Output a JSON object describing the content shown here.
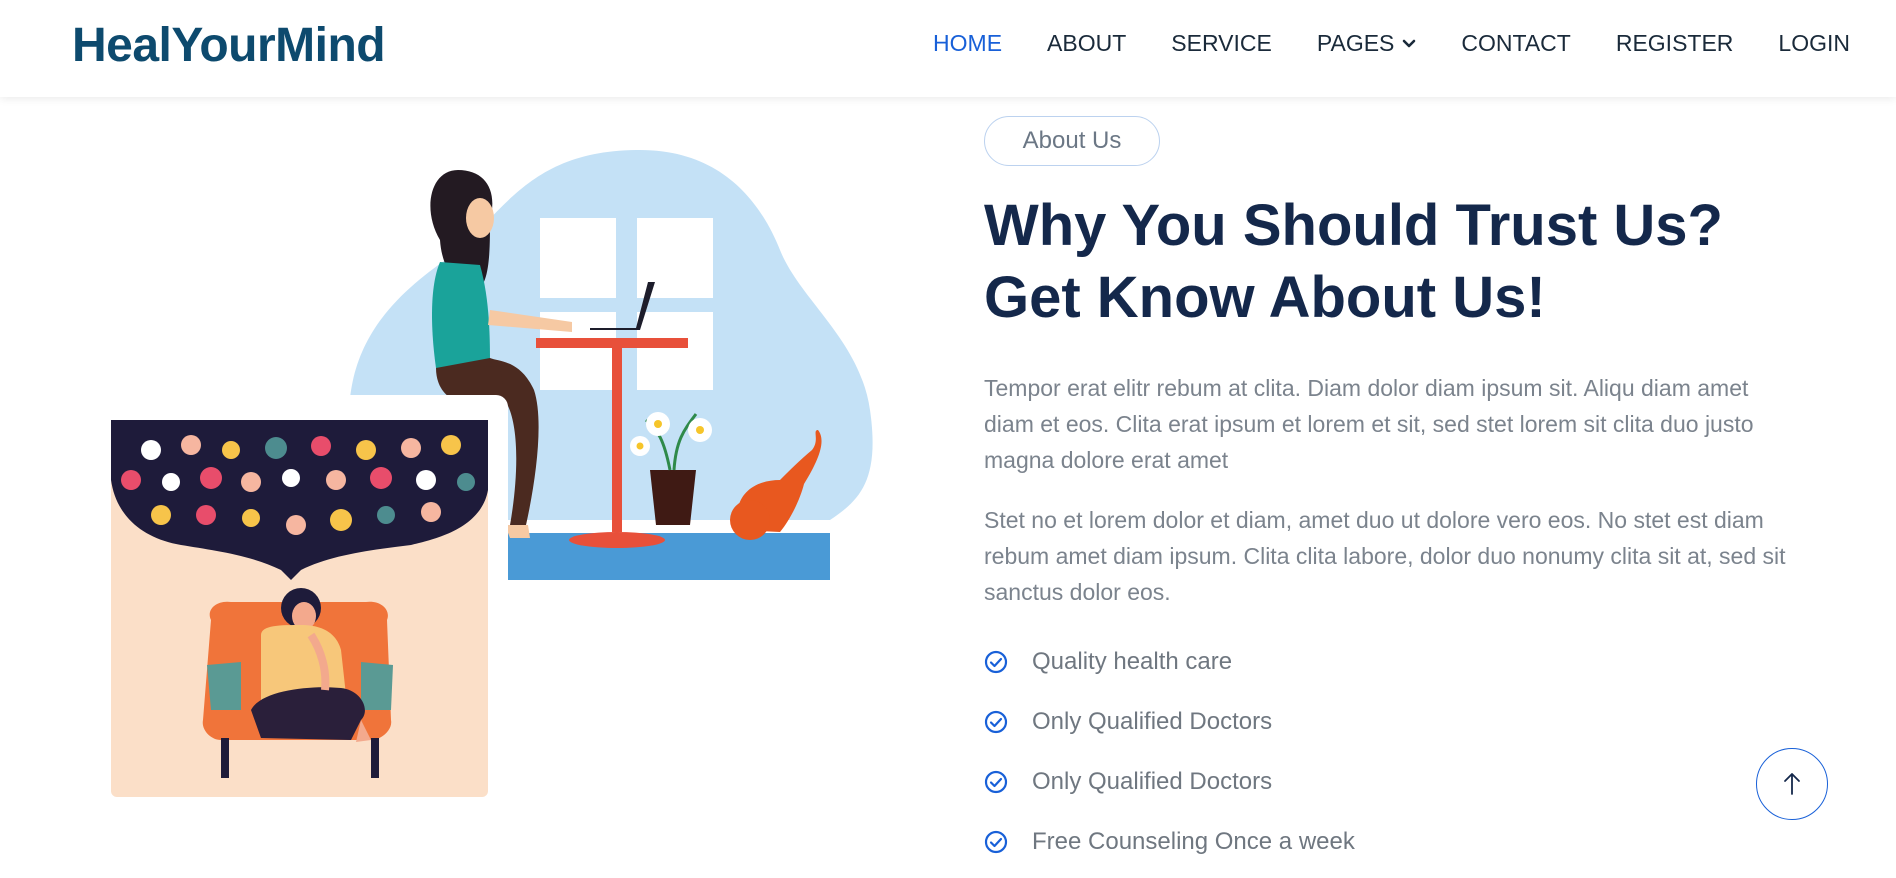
{
  "brand": {
    "name": "HealYourMind",
    "color": "#0d4a6e"
  },
  "nav": {
    "items": [
      {
        "label": "HOME",
        "active": true
      },
      {
        "label": "ABOUT"
      },
      {
        "label": "SERVICE"
      },
      {
        "label": "PAGES",
        "icon": "chevron-down-icon"
      },
      {
        "label": "CONTACT"
      },
      {
        "label": "REGISTER"
      },
      {
        "label": "LOGIN"
      }
    ],
    "accent": "#1860d8"
  },
  "about": {
    "badge": "About Us",
    "title_line1": "Why You Should Trust Us?",
    "title_line2": "Get Know About Us!",
    "paragraph1": "Tempor erat elitr rebum at clita. Diam dolor diam ipsum sit. Aliqu diam amet diam et eos. Clita erat ipsum et lorem et sit, sed stet lorem sit clita duo justo magna dolore erat amet",
    "paragraph2": "Stet no et lorem dolor et diam, amet duo ut dolore vero eos. No stet est diam rebum amet diam ipsum. Clita clita labore, dolor duo nonumy clita sit at, sed sit sanctus dolor eos.",
    "features": [
      "Quality health care",
      "Only Qualified Doctors",
      "Only Qualified Doctors",
      "Free Counseling Once a week"
    ],
    "check_icon": "check-circle-icon"
  },
  "back_to_top_icon": "arrow-up-icon"
}
